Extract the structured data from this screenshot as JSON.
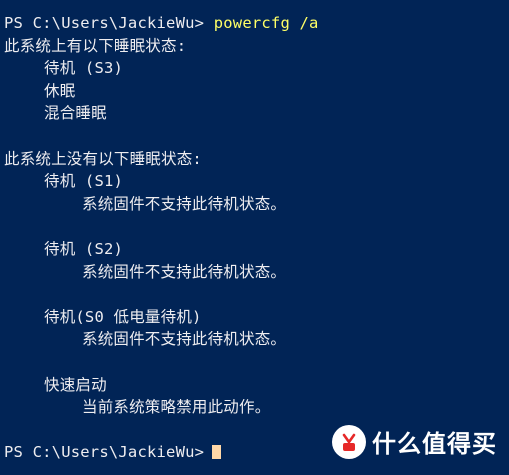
{
  "terminal": {
    "prompt": "PS C:\\Users\\JackieWu>",
    "command": "powercfg /a",
    "lines": [
      "此系统上有以下睡眠状态:",
      "待机 (S3)",
      "休眠",
      "混合睡眠",
      "",
      "此系统上没有以下睡眠状态:",
      "待机 (S1)",
      "系统固件不支持此待机状态。",
      "",
      "待机 (S2)",
      "系统固件不支持此待机状态。",
      "",
      "待机(S0 低电量待机)",
      "系统固件不支持此待机状态。",
      "",
      "快速启动",
      "当前系统策略禁用此动作。",
      ""
    ],
    "final_prompt": "PS C:\\Users\\JackieWu>"
  },
  "watermark": {
    "text": "什么值得买",
    "logo_mark": "值"
  },
  "colors": {
    "background": "#012456",
    "text": "#eeedf0",
    "command": "#ffff66",
    "cursor": "#ffd8a8"
  }
}
